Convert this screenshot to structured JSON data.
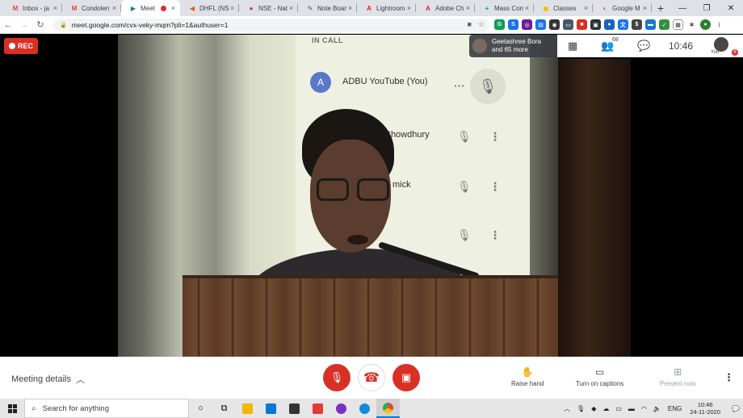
{
  "browser": {
    "tabs": [
      {
        "label": "Inbox - ja",
        "fav": "M",
        "favcolor": "#ea4335"
      },
      {
        "label": "Condolen",
        "fav": "M",
        "favcolor": "#ea4335"
      },
      {
        "label": "Meet",
        "fav": "▶",
        "favcolor": "#00897b",
        "active": true,
        "recording": true
      },
      {
        "label": "DHFL (NSE",
        "fav": "◀",
        "favcolor": "#e8590c"
      },
      {
        "label": "NSE - Nati",
        "fav": "●",
        "favcolor": "#c0392b"
      },
      {
        "label": "Note Boar",
        "fav": "✎",
        "favcolor": "#555555"
      },
      {
        "label": "Lightroom",
        "fav": "A",
        "favcolor": "#e02020"
      },
      {
        "label": "Adobe Ch",
        "fav": "A",
        "favcolor": "#e02020"
      },
      {
        "label": "Mass Com",
        "fav": "+",
        "favcolor": "#0f9d58"
      },
      {
        "label": "Classes",
        "fav": "▣",
        "favcolor": "#f4b400"
      },
      {
        "label": "Google M",
        "fav": "◐",
        "favcolor": "#e8590c"
      }
    ],
    "new_tab": "+",
    "url": "meet.google.com/cvx-veky-mqm?pli=1&authuser=1"
  },
  "meeting": {
    "rec_label": "REC",
    "toast_line1": "Geetashree Bora",
    "toast_line2": "and 65 more",
    "participant_count": "68",
    "time": "10:46",
    "self_label": "You",
    "self_badge": "8",
    "details_label": "Meeting details",
    "actions": {
      "raise_hand": "Raise hand",
      "captions": "Turn on captions",
      "present": "Present now"
    }
  },
  "shared_screen": {
    "heading": "IN CALL",
    "avatar_letter": "A",
    "rows": [
      {
        "name": "ADBU YouTube (You)"
      },
      {
        "name": "Chowdhury"
      },
      {
        "name": "mick"
      }
    ]
  },
  "taskbar": {
    "search_placeholder": "Search for anything",
    "lang": "ENG",
    "clock_time": "10:46",
    "clock_date": "24-11-2020"
  }
}
